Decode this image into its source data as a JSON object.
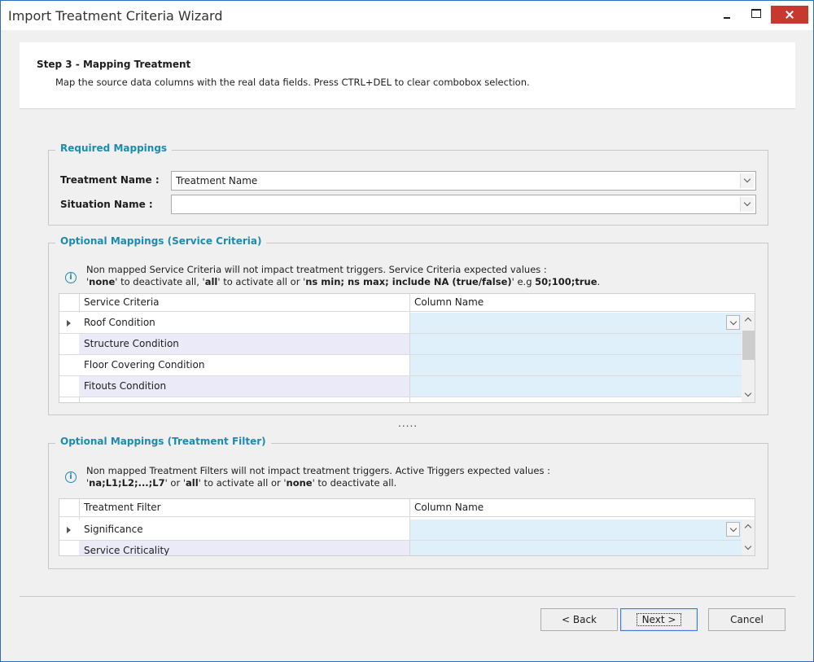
{
  "window": {
    "title": "Import Treatment Criteria Wizard"
  },
  "step": {
    "title": "Step 3 - Mapping Treatment",
    "description": "Map the source data columns with the real data fields. Press CTRL+DEL to clear combobox selection."
  },
  "required": {
    "title": "Required Mappings",
    "treatment_label": "Treatment Name :",
    "treatment_value": "Treatment Name",
    "situation_label": "Situation Name :",
    "situation_value": ""
  },
  "service": {
    "title": "Optional Mappings (Service Criteria)",
    "info_line1": "Non mapped Service Criteria will not impact treatment triggers. Service Criteria expected values :",
    "info_line2": {
      "q1": "'",
      "none": "none",
      "t1": "' to deactivate all, '",
      "all": "all",
      "t2": "' to activate all or '",
      "ns": "ns min; ns max; include NA (true/false)",
      "t3": "' e.g ",
      "eg": "50;100;true",
      "t4": "."
    },
    "col1": "Service Criteria",
    "col2": "Column Name",
    "rows": [
      "Roof Condition",
      "Structure Condition",
      "Floor Covering Condition",
      "Fitouts Condition"
    ]
  },
  "splitter": ".....",
  "filter": {
    "title": "Optional Mappings (Treatment Filter)",
    "info_line1": "Non mapped Treatment Filters will not impact treatment triggers. Active Triggers expected values :",
    "info_line2": {
      "q1": "'",
      "levels": "na;L1;L2;...;L7",
      "t1": "' or '",
      "all": "all",
      "t2": "' to activate all or '",
      "none": "none",
      "t3": "' to deactivate all."
    },
    "col1": "Treatment Filter",
    "col2": "Column Name",
    "rows": [
      "Significance",
      "Service Criticality"
    ]
  },
  "buttons": {
    "back": "< Back",
    "next": "Next >",
    "cancel": "Cancel"
  },
  "colors": {
    "accent": "#1f8aaf",
    "close": "#c7392e",
    "cell_highlight": "#dff0fb",
    "alt_row": "#eaeaf8"
  },
  "icons": [
    "minimize-icon",
    "maximize-icon",
    "close-icon",
    "info-icon",
    "chevron-down-icon",
    "chevron-up-icon",
    "row-indicator-icon"
  ]
}
